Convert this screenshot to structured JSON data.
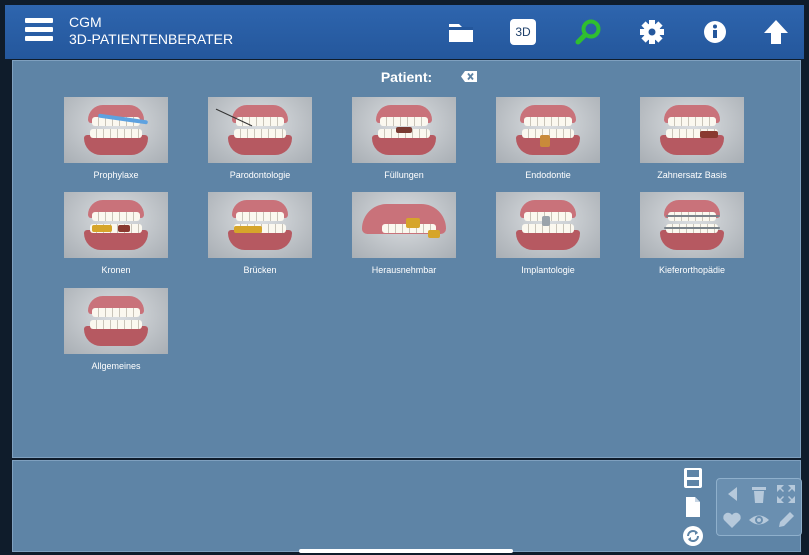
{
  "header": {
    "brand": "CGM",
    "product": "3D-PATIENTENBERATER",
    "btn_3d_label": "3D",
    "icons": [
      "menu-icon",
      "folder-icon",
      "3d-icon",
      "search-icon",
      "gear-icon",
      "info-icon",
      "arrow-up-icon"
    ],
    "search_color": "#2fbf2f"
  },
  "patient": {
    "label": "Patient:",
    "clear_icon": "backspace-icon"
  },
  "topics": [
    {
      "label": "Prophylaxe"
    },
    {
      "label": "Parodontologie"
    },
    {
      "label": "Füllungen"
    },
    {
      "label": "Endodontie"
    },
    {
      "label": "Zahnersatz Basis"
    },
    {
      "label": "Kronen"
    },
    {
      "label": "Brücken"
    },
    {
      "label": "Herausnehmbar"
    },
    {
      "label": "Implantologie"
    },
    {
      "label": "Kieferorthopädie"
    },
    {
      "label": "Allgemeines"
    }
  ],
  "bottom_tools": {
    "side": [
      "save-icon",
      "document-icon",
      "refresh-icon"
    ],
    "pager": [
      "arrow-left-icon",
      "trash-icon",
      "expand-icon",
      "heart-icon",
      "eye-icon",
      "pencil-icon"
    ]
  }
}
